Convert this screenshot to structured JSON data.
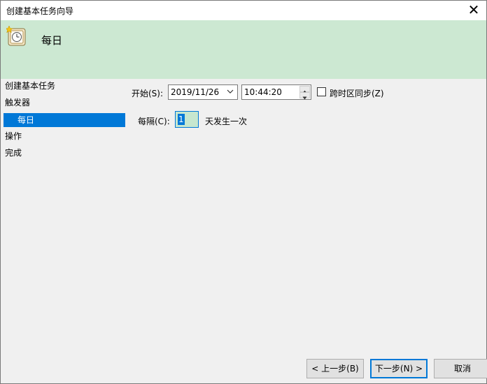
{
  "window": {
    "title": "创建基本任务向导",
    "close_glyph": "✕"
  },
  "header": {
    "icon": "clock-icon",
    "title": "每日"
  },
  "nav": {
    "items": [
      {
        "label": "创建基本任务"
      },
      {
        "label": "触发器"
      },
      {
        "label": "每日",
        "selected": true
      },
      {
        "label": "操作"
      },
      {
        "label": "完成"
      }
    ]
  },
  "form": {
    "start_label": "开始(S):",
    "start_date": "2019/11/26",
    "start_time": "10:44:20",
    "sync_label": "跨时区同步(Z)",
    "sync_checked": false,
    "interval_label": "每隔(C):",
    "interval_value": "1",
    "interval_suffix": "天发生一次"
  },
  "buttons": {
    "back": "< 上一步(B)",
    "next": "下一步(N) >",
    "cancel": "取消"
  },
  "colors": {
    "accent": "#0078d7",
    "header_bg": "#cce8d2",
    "body_bg": "#f0f0f0"
  }
}
